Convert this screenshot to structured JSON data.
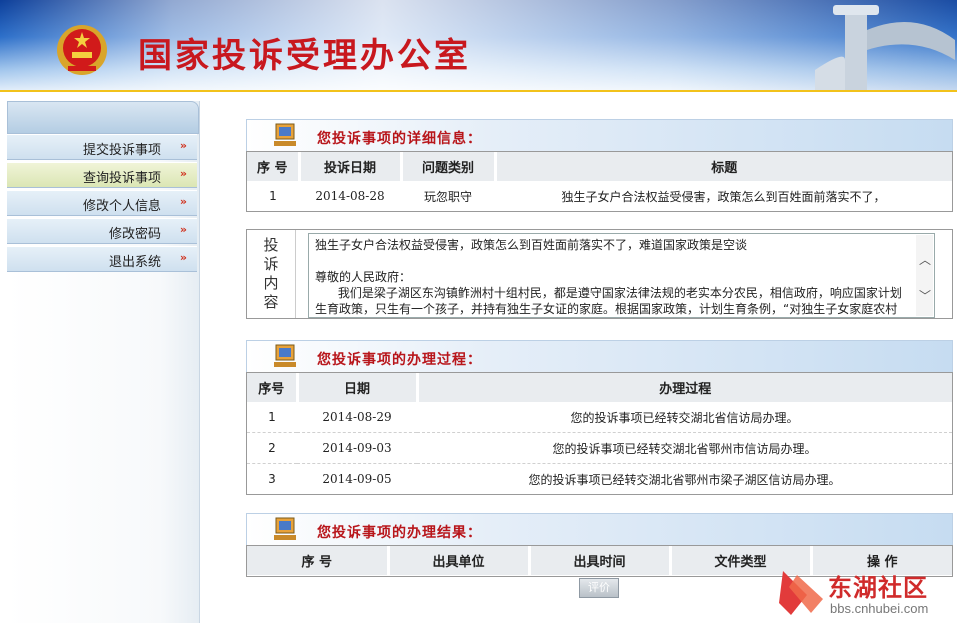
{
  "header": {
    "title": "国家投诉受理办公室"
  },
  "sidebar": {
    "items": [
      {
        "label": "提交投诉事项",
        "arrow": "»",
        "active": false
      },
      {
        "label": "查询投诉事项",
        "arrow": "»",
        "active": true
      },
      {
        "label": "修改个人信息",
        "arrow": "»",
        "active": false
      },
      {
        "label": "修改密码",
        "arrow": "»",
        "active": false
      },
      {
        "label": "退出系统",
        "arrow": "»",
        "active": false
      }
    ]
  },
  "details": {
    "title": "您投诉事项的详细信息：",
    "columns": [
      "序 号",
      "投诉日期",
      "问题类别",
      "标题"
    ],
    "row": {
      "no": "1",
      "date": "2014-08-28",
      "category": "玩忽职守",
      "subject": "独生子女户合法权益受侵害，政策怎么到百姓面前落实不了，"
    }
  },
  "content": {
    "label": "投诉内容",
    "text": "独生子女户合法权益受侵害，政策怎么到百姓面前落实不了，难道国家政策是空谈\n\n尊敬的人民政府：\n      我们是梁子湖区东沟镇鲊洲村十组村民，都是遵守国家法律法规的老实本分农民，相信政府，响应国家计划生育政策，只生有一个孩子，并持有独生子女证的家庭。根据国家政策，计划生育条例，“对独生子女家庭农村有分配集体福利、经济利益、宅基地、调整责任田、自留山上"
  },
  "process": {
    "title": "您投诉事项的办理过程：",
    "columns": [
      "序号",
      "日期",
      "办理过程"
    ],
    "rows": [
      {
        "no": "1",
        "date": "2014-08-29",
        "desc": "您的投诉事项已经转交湖北省信访局办理。"
      },
      {
        "no": "2",
        "date": "2014-09-03",
        "desc": "您的投诉事项已经转交湖北省鄂州市信访局办理。"
      },
      {
        "no": "3",
        "date": "2014-09-05",
        "desc": "您的投诉事项已经转交湖北省鄂州市梁子湖区信访局办理。"
      }
    ]
  },
  "result": {
    "title": "您投诉事项的办理结果：",
    "columns": [
      "序 号",
      "出具单位",
      "出具时间",
      "文件类型",
      "操 作"
    ]
  },
  "eval_button": "评价",
  "watermark": {
    "brand": "东湖社区",
    "url": "bbs.cnhubei.com"
  },
  "colors": {
    "title_red": "#c8181e",
    "panel_title_red": "#b8161b",
    "banner_blue": "#2d6fc9",
    "nav_active": "#dbe6b4"
  }
}
